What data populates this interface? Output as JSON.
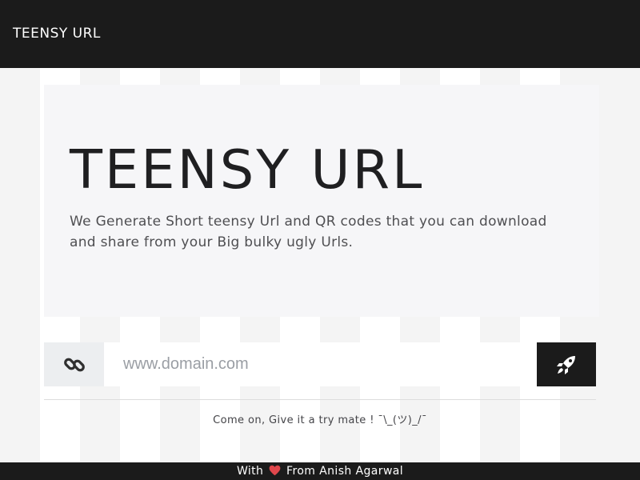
{
  "navbar": {
    "brand": "TEENSY URL"
  },
  "hero": {
    "title": "TEENSY URL",
    "description": "We Generate Short teensy Url and QR codes that you can download and share from your Big bulky ugly Urls."
  },
  "form": {
    "prefix_icon": "link-icon",
    "url_placeholder": "www.domain.com",
    "url_value": "",
    "submit_icon": "rocket-icon"
  },
  "tagline": "Come on, Give it a try mate ! ¯\\_(ツ)_/¯",
  "footer": {
    "before": "With",
    "heart_icon": "heart-icon",
    "after": "From Anish Agarwal"
  },
  "colors": {
    "dark": "#1b1b1b",
    "heart": "#e0474c",
    "hero_bg": "#f6f6f8",
    "placeholder": "#9a9ea4"
  }
}
